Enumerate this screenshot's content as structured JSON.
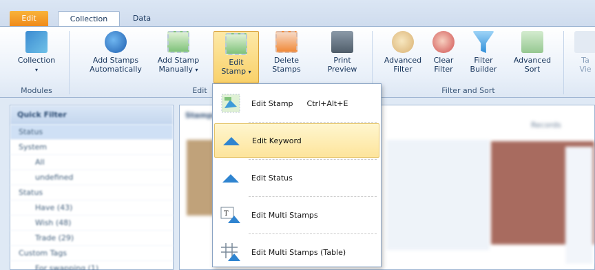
{
  "tabs": {
    "edit": "Edit",
    "collection": "Collection",
    "data": "Data"
  },
  "ribbon": {
    "collection": "Collection",
    "add_auto_1": "Add Stamps",
    "add_auto_2": "Automatically",
    "add_manual_1": "Add Stamp",
    "add_manual_2": "Manually",
    "edit_stamp_1": "Edit",
    "edit_stamp_2": "Stamp",
    "delete_1": "Delete",
    "delete_2": "Stamps",
    "print_1": "Print",
    "print_2": "Preview",
    "adv_filter_1": "Advanced",
    "adv_filter_2": "Filter",
    "clear_filter_1": "Clear",
    "clear_filter_2": "Filter",
    "filter_builder_1": "Filter",
    "filter_builder_2": "Builder",
    "adv_sort_1": "Advanced",
    "adv_sort_2": "Sort",
    "table_view_1": "Ta",
    "table_view_2": "Vie",
    "groups": {
      "modules": "Modules",
      "edit": "Edit",
      "filter_sort": "Filter and Sort"
    }
  },
  "left_panel": {
    "title": "Quick Filter",
    "rows": [
      "Status",
      "System",
      "All",
      "undefined",
      "Status",
      "Have (43)",
      "Wish (48)",
      "Trade (29)",
      "Custom Tags",
      "For swapping (1)"
    ]
  },
  "right_area": {
    "title": "Stamps",
    "records": "Records"
  },
  "menu": {
    "items": [
      {
        "label": "Edit Stamp",
        "shortcut": "Ctrl+Alt+E"
      },
      {
        "label": "Edit Keyword"
      },
      {
        "label": "Edit Status"
      },
      {
        "label": "Edit Multi Stamps"
      },
      {
        "label": "Edit Multi Stamps (Table)"
      }
    ]
  }
}
